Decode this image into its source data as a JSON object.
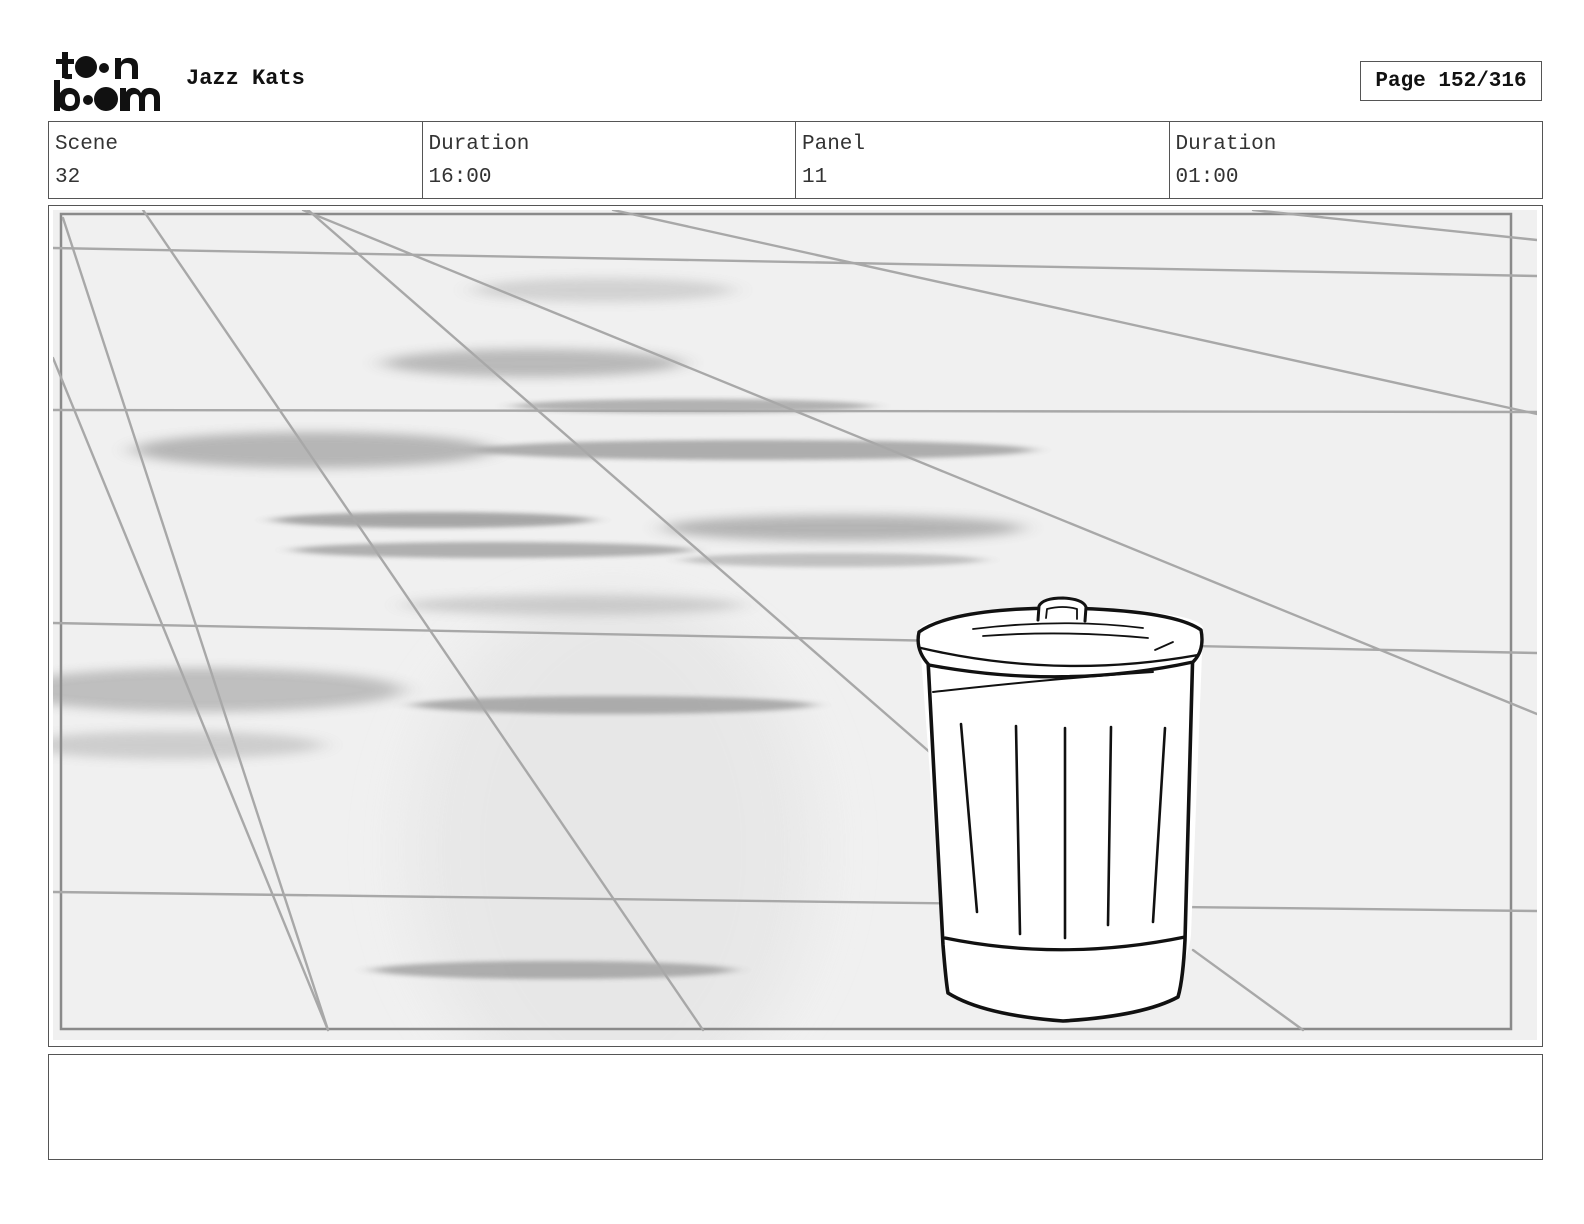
{
  "header": {
    "logo_text": "toon boom",
    "project_title": "Jazz Kats",
    "page_label": "Page 152/316"
  },
  "info": {
    "scene_label": "Scene",
    "scene_value": "32",
    "scene_duration_label": "Duration",
    "scene_duration_value": "16:00",
    "panel_label": "Panel",
    "panel_value": "11",
    "panel_duration_label": "Duration",
    "panel_duration_value": "01:00"
  },
  "panel": {
    "drawing": "trash-can-on-tiled-floor-sketch"
  },
  "notes": {
    "text": ""
  }
}
